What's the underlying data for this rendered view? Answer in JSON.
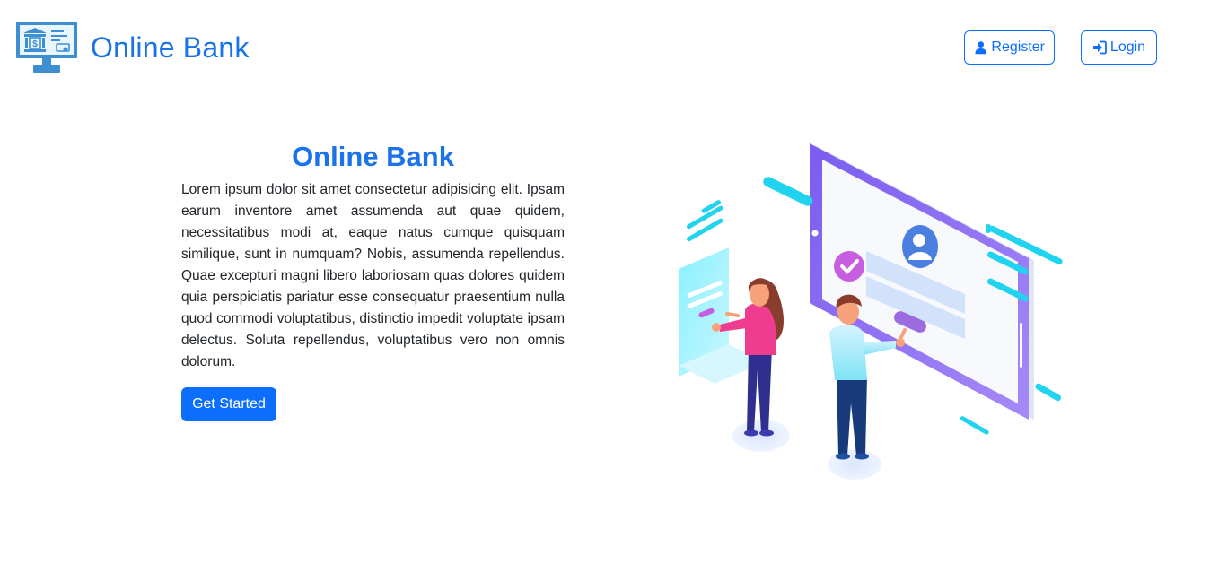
{
  "header": {
    "brand_name": "Online Bank",
    "register_label": "Register",
    "login_label": "Login"
  },
  "hero": {
    "title": "Online Bank",
    "body": "Lorem ipsum dolor sit amet consectetur adipisicing elit. Ipsam earum inventore amet assumenda aut quae quidem, necessitatibus modi at, eaque natus cumque quisquam similique, sunt in numquam? Nobis, assumenda repellendus. Quae excepturi magni libero laboriosam quas dolores quidem quia perspiciatis pariatur esse consequatur praesentium nulla quod commodi voluptatibus, distinctio impedit voluptate ipsam delectus. Soluta repellendus, voluptatibus vero non omnis dolorum.",
    "cta_label": "Get Started"
  },
  "icons": {
    "logo": "bank-monitor-icon",
    "register": "user-icon",
    "login": "sign-in-icon"
  },
  "colors": {
    "brand": "#1a73e8",
    "primary": "#0d6efd",
    "text": "#212529",
    "background": "#ffffff"
  }
}
